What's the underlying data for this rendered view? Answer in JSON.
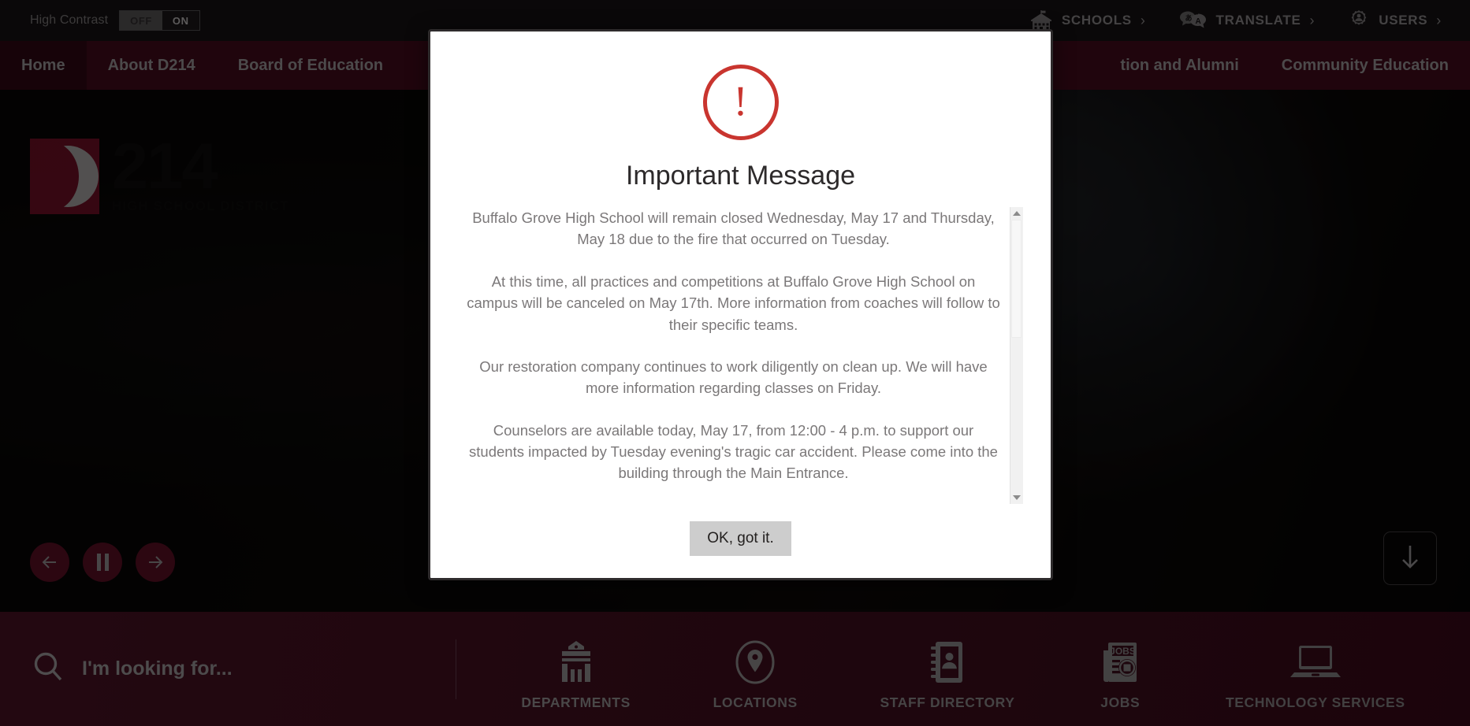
{
  "utility": {
    "high_contrast_label": "High Contrast",
    "toggle_off": "OFF",
    "toggle_on": "ON",
    "items": [
      {
        "label": "SCHOOLS",
        "icon": "school-building-icon",
        "chevron": "›"
      },
      {
        "label": "TRANSLATE",
        "icon": "translate-icon",
        "chevron": "›"
      },
      {
        "label": "USERS",
        "icon": "users-gear-icon",
        "chevron": "›"
      }
    ]
  },
  "nav": {
    "items": [
      {
        "label": "Home",
        "active": true
      },
      {
        "label": "About D214",
        "active": false
      },
      {
        "label": "Board of Education",
        "active": false
      }
    ],
    "right_items": [
      {
        "label": "tion and Alumni",
        "active": false
      },
      {
        "label": "Community Education",
        "active": false
      }
    ]
  },
  "hero": {
    "logo": {
      "number": "214",
      "subtitle": "HIGH SCHOOL DISTRICT",
      "mark": "d214-crescent-logo"
    },
    "carousel": {
      "prev": "previous-slide",
      "pause": "pause-slideshow",
      "next": "next-slide"
    },
    "scroll_down": "scroll-down-arrow"
  },
  "quicklinks": {
    "search_placeholder": "I'm looking for...",
    "items": [
      {
        "label": "DEPARTMENTS",
        "icon": "building-columns-icon"
      },
      {
        "label": "LOCATIONS",
        "icon": "map-pin-icon"
      },
      {
        "label": "STAFF DIRECTORY",
        "icon": "address-book-icon"
      },
      {
        "label": "JOBS",
        "icon": "jobs-newspaper-icon"
      },
      {
        "label": "TECHNOLOGY SERVICES",
        "icon": "laptop-icon"
      }
    ]
  },
  "modal": {
    "icon": "exclamation-circle-icon",
    "icon_glyph": "!",
    "title": "Important Message",
    "paragraphs": [
      "Buffalo Grove High School will remain closed Wednesday, May 17 and Thursday, May 18 due to the fire that occurred on Tuesday.",
      "At this time, all practices and competitions at Buffalo Grove High School on campus will be canceled on May 17th. More information from coaches will follow to their specific teams.",
      "Our restoration company continues to work diligently on clean up. We will have more information regarding classes on Friday.",
      "Counselors are available today, May 17, from 12:00 - 4 p.m. to support our students impacted by Tuesday evening's tragic car accident. Please come into the building through the Main Entrance."
    ],
    "ok_label": "OK, got it."
  },
  "colors": {
    "brand_maroon": "#3d0b1b",
    "brand_dark_maroon": "#2a0711",
    "logo_red": "#7a1028",
    "alert_red": "#c9352f",
    "utility_bg": "#131011"
  }
}
